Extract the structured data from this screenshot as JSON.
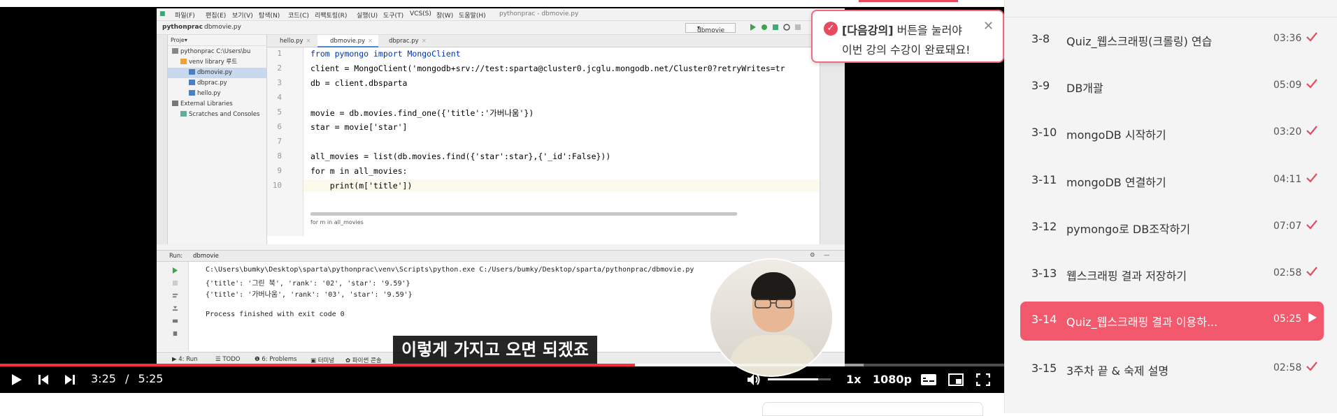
{
  "ide": {
    "menus": [
      "파일(F)",
      "편집(E)",
      "보기(V)",
      "탐색(N)",
      "코드(C)",
      "리팩토링(R)",
      "실행(U)",
      "도구(T)",
      "VCS(S)",
      "창(W)",
      "도움말(H)"
    ],
    "window_title": "pythonprac - dbmovie.py",
    "breadcrumb_project": "pythonprac",
    "breadcrumb_file": "dbmovie.py",
    "run_config": "dbmovie",
    "project_header": "Proje▾",
    "tree": [
      {
        "label": "pythonprac  C:\\Users\\bu",
        "selected": false
      },
      {
        "label": "venv  library 루트",
        "selected": false
      },
      {
        "label": "dbmovie.py",
        "selected": true
      },
      {
        "label": "dbprac.py",
        "selected": false
      },
      {
        "label": "hello.py",
        "selected": false
      },
      {
        "label": "External Libraries",
        "selected": false
      },
      {
        "label": "Scratches and Consoles",
        "selected": false
      }
    ],
    "tabs": [
      "hello.py",
      "dbmovie.py",
      "dbprac.py"
    ],
    "line_numbers": [
      "1",
      "2",
      "3",
      "4",
      "5",
      "6",
      "7",
      "8",
      "9",
      "10"
    ],
    "code_lines": [
      "from pymongo import MongoClient",
      "client = MongoClient('mongodb+srv://test:sparta@cluster0.jcglu.mongodb.net/Cluster0?retryWrites=tr",
      "db = client.dbsparta",
      "",
      "movie = db.movies.find_one({'title':'가버나움'})",
      "star = movie['star']",
      "",
      "all_movies = list(db.movies.find({'star':star},{'_id':False}))",
      "for m in all_movies:",
      "    print(m['title'])"
    ],
    "editor_status": "for m in all_movies",
    "run_tab": "dbmovie",
    "run_label": "Run:",
    "output_lines": [
      "C:\\Users\\bumky\\Desktop\\sparta\\pythonprac\\venv\\Scripts\\python.exe C:/Users/bumky/Desktop/sparta/pythonprac/dbmovie.py",
      "{'title': '그린 북', 'rank': '02', 'star': '9.59'}",
      "{'title': '가버나움', 'rank': '03', 'star': '9.59'}",
      "",
      "Process finished with exit code 0"
    ],
    "bottom_tabs": [
      "▶ 4: Run",
      "☰ TODO",
      "❶ 6: Problems",
      "▣ 터미널",
      "✿ 파이썬 콘솔"
    ]
  },
  "notice": {
    "highlight": "[다음강의]",
    "line1_rest": " 버튼을 눌러야",
    "line2": "이번 강의 수강이 완료돼요!",
    "close": "✕"
  },
  "subtitle": "이렇게 가지고 오면 되겠죠",
  "player": {
    "current_time": "3:25",
    "separator": "/",
    "duration": "5:25",
    "speed": "1x",
    "quality": "1080p",
    "progress_fraction": 0.632,
    "buffer_fraction": 0.86,
    "volume_fraction": 0.8,
    "accent_color": "#ff2d3a"
  },
  "sidebar": {
    "lessons": [
      {
        "num": "3-8",
        "title": "Quiz_웹스크래핑(크롤링) 연습",
        "duration": "03:36",
        "status": "done"
      },
      {
        "num": "3-9",
        "title": "DB개괄",
        "duration": "05:09",
        "status": "done"
      },
      {
        "num": "3-10",
        "title": "mongoDB 시작하기",
        "duration": "03:20",
        "status": "done"
      },
      {
        "num": "3-11",
        "title": "mongoDB 연결하기",
        "duration": "04:11",
        "status": "done"
      },
      {
        "num": "3-12",
        "title": "pymongo로 DB조작하기",
        "duration": "07:07",
        "status": "done"
      },
      {
        "num": "3-13",
        "title": "웹스크래핑 결과 저장하기",
        "duration": "02:58",
        "status": "done"
      },
      {
        "num": "3-14",
        "title": "Quiz_웹스크래핑 결과 이용하...",
        "duration": "05:25",
        "status": "playing"
      },
      {
        "num": "3-15",
        "title": "3주차 끝 & 숙제 설명",
        "duration": "02:58",
        "status": "done"
      }
    ],
    "accent_color": "#f2596c",
    "check_color": "#e84a5f"
  }
}
